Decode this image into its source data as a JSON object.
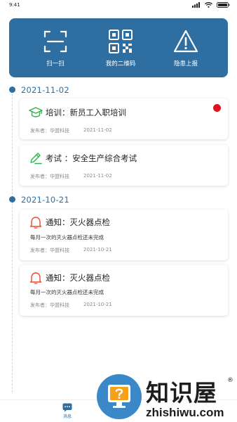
{
  "status_bar": {
    "time": "9:41"
  },
  "quick_actions": [
    {
      "label": "扫一扫",
      "icon": "scan-icon"
    },
    {
      "label": "我的二维码",
      "icon": "qr-code-icon"
    },
    {
      "label": "隐患上报",
      "icon": "warning-icon"
    }
  ],
  "groups": [
    {
      "date": "2021-11-02",
      "items": [
        {
          "title": "培训：新员工入职培训",
          "icon": "graduation-cap-icon",
          "icon_color": "#2bb24c",
          "description": "",
          "publisher": "发布者：华盟科技",
          "date": "2021-11-02",
          "unread": true
        },
        {
          "title": "考试 ：安全生产综合考试",
          "icon": "pencil-icon",
          "icon_color": "#2bb24c",
          "description": "",
          "publisher": "发布者：华盟科技",
          "date": "2021-11-02",
          "unread": false
        }
      ]
    },
    {
      "date": "2021-10-21",
      "items": [
        {
          "title": "通知：灭火器点检",
          "icon": "bell-icon",
          "icon_color": "#f04a2a",
          "description": "每月一次的灭火器点检还未完成",
          "publisher": "发布者：华盟科技",
          "date": "2021-10-21",
          "unread": false
        },
        {
          "title": "通知：灭火器点检",
          "icon": "bell-icon",
          "icon_color": "#f04a2a",
          "description": "每月一次的灭火器点检还未完成",
          "publisher": "发布者：华盟科技",
          "date": "2021-10-21",
          "unread": false
        }
      ]
    }
  ],
  "bottom_nav": {
    "messages_label": "消息"
  },
  "watermark": {
    "chinese": "知识屋",
    "registered": "®",
    "english": "zhishiwu.com"
  },
  "colors": {
    "primary": "#2f6ea0",
    "unread": "#e0141e",
    "green_icon": "#2bb24c",
    "red_icon": "#f04a2a"
  }
}
